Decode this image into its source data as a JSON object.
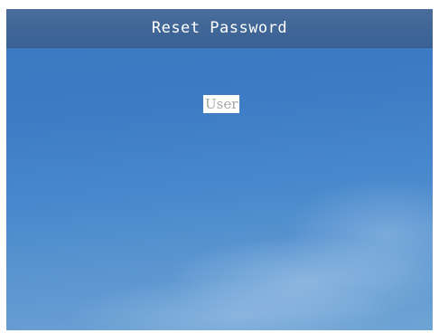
{
  "screen": {
    "title": "Reset Password",
    "field_label": "User"
  }
}
